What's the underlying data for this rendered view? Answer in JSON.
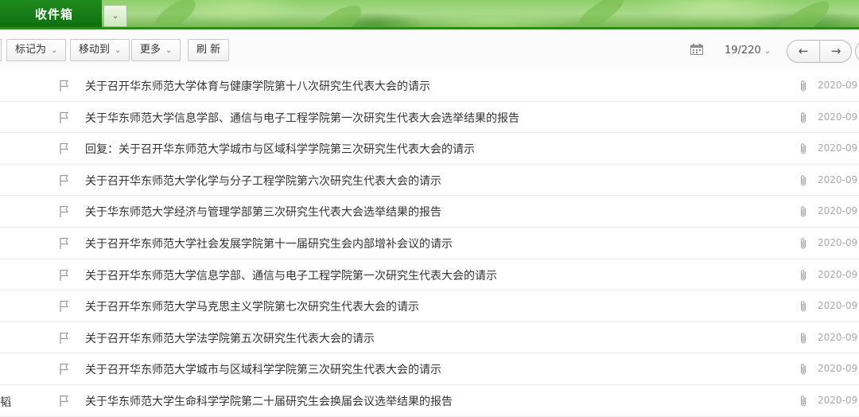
{
  "header": {
    "active_tab": "收件箱",
    "tab_menu_icon": "chevron-down-icon"
  },
  "toolbar": {
    "buttons": [
      {
        "label": "标记为",
        "has_dropdown": true
      },
      {
        "label": "移动到",
        "has_dropdown": true
      },
      {
        "label": "更多",
        "has_dropdown": true
      },
      {
        "label": "刷 新",
        "has_dropdown": false
      }
    ],
    "calendar_icon": "calendar-icon",
    "page_indicator": "19/220",
    "prev_icon": "arrow-left-icon",
    "next_icon": "arrow-right-icon"
  },
  "messages": [
    {
      "sender": "",
      "subject": "关于召开华东师范大学体育与健康学院第十八次研究生代表大会的请示",
      "date": "2020-09"
    },
    {
      "sender": "",
      "subject": "关于华东师范大学信息学部、通信与电子工程学院第一次研究生代表大会选举结果的报告",
      "date": "2020-09"
    },
    {
      "sender": "",
      "subject": "回复：关于召开华东师范大学城市与区域科学学院第三次研究生代表大会的请示",
      "date": "2020-09"
    },
    {
      "sender": "",
      "subject": "关于召开华东师范大学化学与分子工程学院第六次研究生代表大会的请示",
      "date": "2020-09"
    },
    {
      "sender": "",
      "subject": "关于华东师范大学经济与管理学部第三次研究生代表大会选举结果的报告",
      "date": "2020-09"
    },
    {
      "sender": "",
      "subject": "关于召开华东师范大学社会发展学院第十一届研究生会内部增补会议的请示",
      "date": "2020-09"
    },
    {
      "sender": "",
      "subject": "关于召开华东师范大学信息学部、通信与电子工程学院第一次研究生代表大会的请示",
      "date": "2020-09"
    },
    {
      "sender": "",
      "subject": "关于召开华东师范大学马克思主义学院第七次研究生代表大会的请示",
      "date": "2020-09"
    },
    {
      "sender": "",
      "subject": "关于召开华东师范大学法学院第五次研究生代表大会的请示",
      "date": "2020-09"
    },
    {
      "sender": "",
      "subject": "关于召开华东师范大学城市与区域科学学院第三次研究生代表大会的请示",
      "date": "2020-09"
    },
    {
      "sender": "韬",
      "subject": "关于华东师范大学生命科学学院第二十届研究生会换届会议选举结果的报告",
      "date": "2020-09"
    }
  ]
}
